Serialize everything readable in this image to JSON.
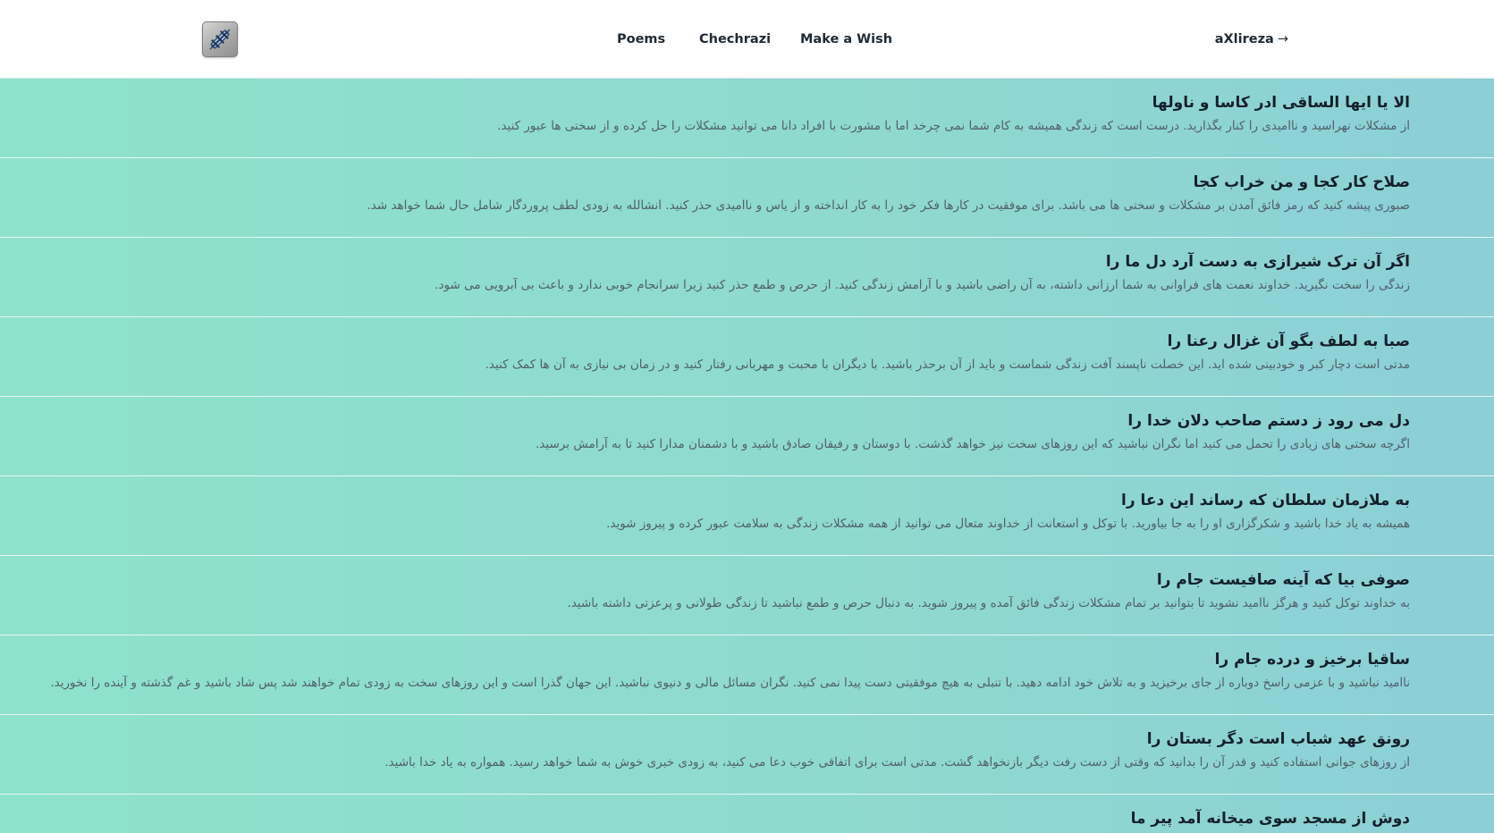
{
  "nav": {
    "logo_icon": "telescope-tile-icon",
    "links": [
      "Poems",
      "Chechrazi",
      "Make a Wish"
    ],
    "user": "aXlireza",
    "user_arrow": "→"
  },
  "colors": {
    "list_gradient_start": "#8ee2cc",
    "list_gradient_end": "#8ccfd6",
    "title": "#15202b",
    "description": "#51606b"
  },
  "poems": [
    {
      "title": "الا یا ایها الساقی ادر کاسا و ناولها",
      "description": "از مشکلات نهراسید و ناامیدی را کنار بگذارید. درست است که زندگی همیشه به کام شما نمی چرخد اما با مشورت با افراد دانا می توانید مشکلات را حل کرده و از سختی ها عبور کنید."
    },
    {
      "title": "صلاح کار کجا و من خراب کجا",
      "description": "صبوری پیشه کنید که رمز فائق آمدن بر مشکلات و سختی ها می باشد. برای موفقیت در کارها فکر خود را به کار انداخته و از یاس و ناامیدی حذر کنید. انشالله به زودی لطف پروردگار شامل حال شما خواهد شد."
    },
    {
      "title": "اگر آن ترک شیرازی به دست آرد دل ما را",
      "description": "زندگی را سخت نگیرید. خداوند نعمت های فراوانی به شما ارزانی داشته، به آن راضی باشید و با آرامش زندگی کنید. از حرص و طمع حذر کنید زیرا سرانجام خوبی ندارد و باعث بی آبرویی می شود."
    },
    {
      "title": "صبا به لطف بگو آن غزال رعنا را",
      "description": "مدتی است دچار کبر و خودبینی شده اید. این خصلت ناپسند آفت زندگی شماست و باید از آن برحذر باشید. با دیگران با محبت و مهربانی رفتار کنید و در زمان بی نیازی به آن ها کمک کنید."
    },
    {
      "title": "دل می رود ز دستم صاحب دلان خدا را",
      "description": "اگرچه سختی های زیادی را تحمل می کنید اما نگران نباشید که این روزهای سخت نیز خواهد گذشت. با دوستان و رفیقان صادق باشید و با دشمنان مدارا کنید تا به آرامش برسید."
    },
    {
      "title": "به ملازمان سلطان که رساند این دعا را",
      "description": "همیشه به یاد خدا باشید و شکرگزاری او را به جا بیاورید. با توکل و استعانت از خداوند متعال می توانید از همه مشکلات زندگی به سلامت عبور کرده و پیروز شوید."
    },
    {
      "title": "صوفی بیا که آینه صافیست جام را",
      "description": "به خداوند توکل کنید و هرگز ناامید نشوید تا بتوانید بر تمام مشکلات زندگی فائق آمده و پیروز شوید. به دنبال حرص و طمع نباشید تا زندگی طولانی و پرعزتی داشته باشید."
    },
    {
      "title": "ساقیا برخیز و درده جام را",
      "description": "ناامید نباشید و با عزمی راسخ دوباره از جای برخیزید و به تلاش خود ادامه دهید. با تنبلی به هیچ موفقیتی دست پیدا نمی کنید. نگران مسائل مالی و دنیوی نباشید. این جهان گذرا است و این روزهای سخت به زودی تمام خواهند شد پس شاد باشید و غم گذشته و آینده را نخورید."
    },
    {
      "title": "رونق عهد شباب است دگر بستان را",
      "description": "از روزهای جوانی استفاده کنید و قدر آن را بدانید که وقتی از دست رفت دیگر بازنخواهد گشت. مدتی است برای اتفاقی خوب دعا می کنید، به زودی خبری خوش به شما خواهد رسید. همواره به یاد خدا باشید."
    },
    {
      "title": "دوش از مسجد سوی میخانه آمد پیر ما",
      "description": ""
    }
  ]
}
